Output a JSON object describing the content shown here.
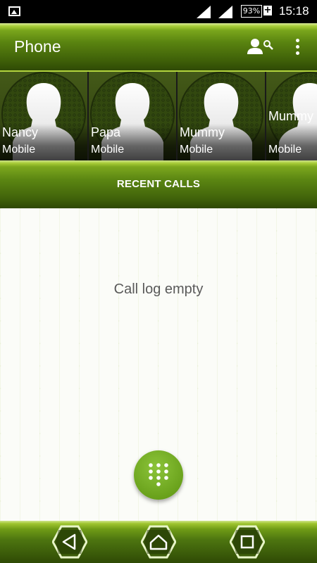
{
  "status_bar": {
    "battery_percent": "93%",
    "time": "15:18"
  },
  "app_bar": {
    "title": "Phone"
  },
  "favorites": [
    {
      "name": "Nancy",
      "type": "Mobile"
    },
    {
      "name": "Papa",
      "type": "Mobile"
    },
    {
      "name": "Mummy",
      "type": "Mobile"
    },
    {
      "name": "Mummy Kalkaji",
      "type": "Mobile"
    }
  ],
  "recent_calls": {
    "label": "RECENT CALLS",
    "empty_message": "Call log empty"
  },
  "colors": {
    "accent_green": "#6aa21c",
    "dark_green": "#2f4a05"
  },
  "icons": {
    "dialpad": "dialpad-icon",
    "contact_search": "person-search-icon",
    "overflow": "more-vert-icon",
    "back": "back-icon",
    "home": "home-icon",
    "recents": "recents-icon"
  }
}
